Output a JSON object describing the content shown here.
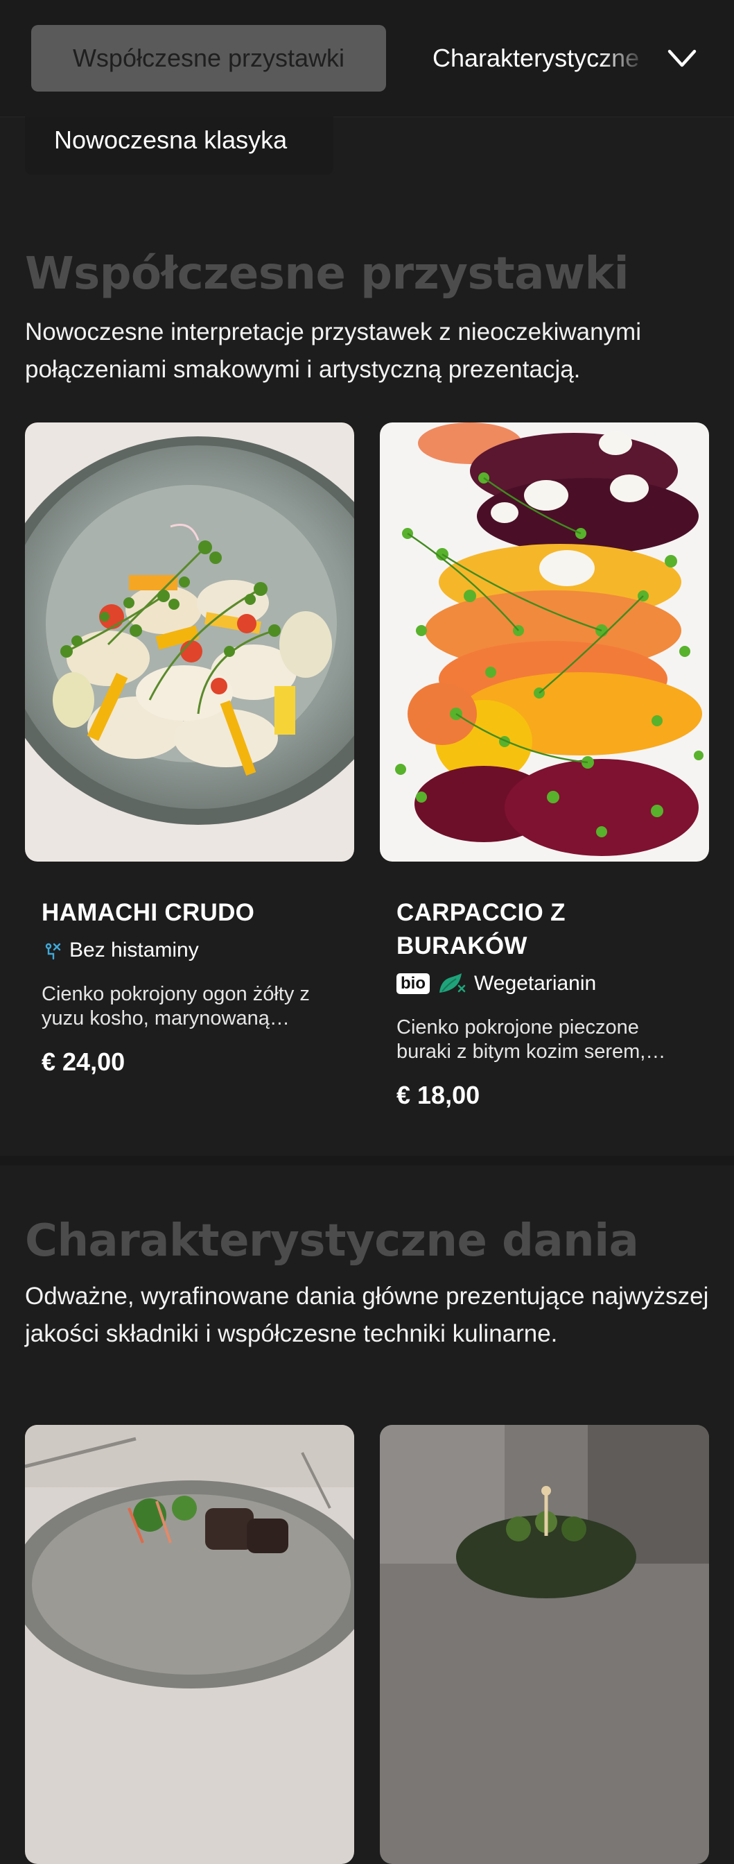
{
  "nav": {
    "tabs": [
      {
        "label": "Współczesne przystawki",
        "active": true
      },
      {
        "label": "Charakterystyczne dania",
        "active": false
      },
      {
        "label": "Nowoczesna klasyka",
        "active": false
      }
    ],
    "expand_icon": "chevron-down-icon"
  },
  "sections": [
    {
      "title": "Współczesne przystawki",
      "description": "Nowoczesne interpretacje przystawek z nieoczekiwanymi połączeniami smakowymi i artystyczną prezentacją.",
      "items": [
        {
          "name": "HAMACHI CRUDO",
          "tags": [
            {
              "icon": "histamine-free-icon",
              "label": "Bez histaminy"
            }
          ],
          "description": "Cienko pokrojony ogon żółty z yuzu kosho, marynowaną…",
          "price": "€ 24,00"
        },
        {
          "name": "CARPACCIO Z BURAKÓW",
          "badge": "bio",
          "tags": [
            {
              "icon": "vegetarian-icon",
              "label": "Wegetarianin"
            }
          ],
          "description": "Cienko pokrojone pieczone buraki z bitym kozim serem,…",
          "price": "€ 18,00"
        }
      ]
    },
    {
      "title": "Charakterystyczne dania",
      "description": "Odważne, wyrafinowane dania główne prezentujące najwyższej jakości składniki i współczesne techniki kulinarne."
    }
  ],
  "colors": {
    "background": "#1d1d1d",
    "active_tab": "#5a5a5a",
    "section_title": "#4c4c4c",
    "histamine_icon": "#3fa9d9",
    "vegetarian_icon": "#1fa37a"
  }
}
